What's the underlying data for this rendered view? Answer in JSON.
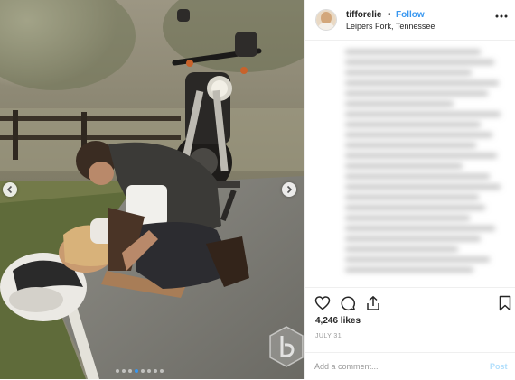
{
  "post": {
    "username": "tifforelie",
    "separator": "•",
    "follow_label": "Follow",
    "location": "Leipers Fork, Tennessee",
    "likes": "4,246 likes",
    "date": "JULY 31"
  },
  "comment": {
    "placeholder": "Add a comment...",
    "post_label": "Post"
  },
  "icons": {
    "more": "more-options-icon",
    "like": "heart-icon",
    "comment": "comment-bubble-icon",
    "share": "share-icon",
    "save": "bookmark-icon",
    "prev": "chevron-left-icon",
    "next": "chevron-right-icon"
  },
  "carousel": {
    "slides": 8,
    "active_index": 3
  },
  "colors": {
    "follow": "#3897f0",
    "post_disabled": "#b2dffc",
    "muted": "#999999"
  }
}
